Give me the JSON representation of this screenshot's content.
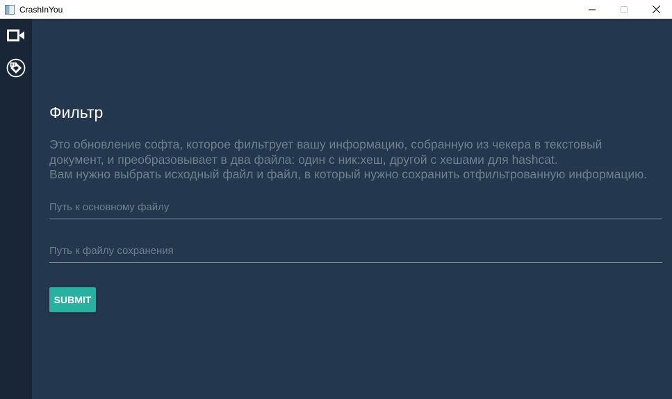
{
  "window": {
    "title": "CrashInYou",
    "controls": [
      "minimize-icon",
      "maximize-icon",
      "close-icon"
    ]
  },
  "sidebar": {
    "items": [
      {
        "icon": "video-camera-icon"
      },
      {
        "icon": "logo-badge-icon"
      }
    ]
  },
  "main": {
    "title": "Фильтр",
    "description_lines": [
      "Это обновление софта, которое фильтрует вашу информацию, собранную из чекера в текстовый",
      "документ, и преобразовывает в два файла: один с ник:хеш, другой с хешами для hashcat.",
      "Вам нужно выбрать исходный файл и файл, в который нужно сохранить отфильтрованную информацию."
    ],
    "source_field": {
      "placeholder": "Путь к основному файлу",
      "value": ""
    },
    "save_field": {
      "placeholder": "Путь к файлу сохранения",
      "value": ""
    },
    "submit_label": "SUBMIT"
  },
  "colors": {
    "background": "#23384f",
    "sidebar": "#182638",
    "accent": "#26b1a1",
    "muted_text": "#6f7f8e"
  }
}
